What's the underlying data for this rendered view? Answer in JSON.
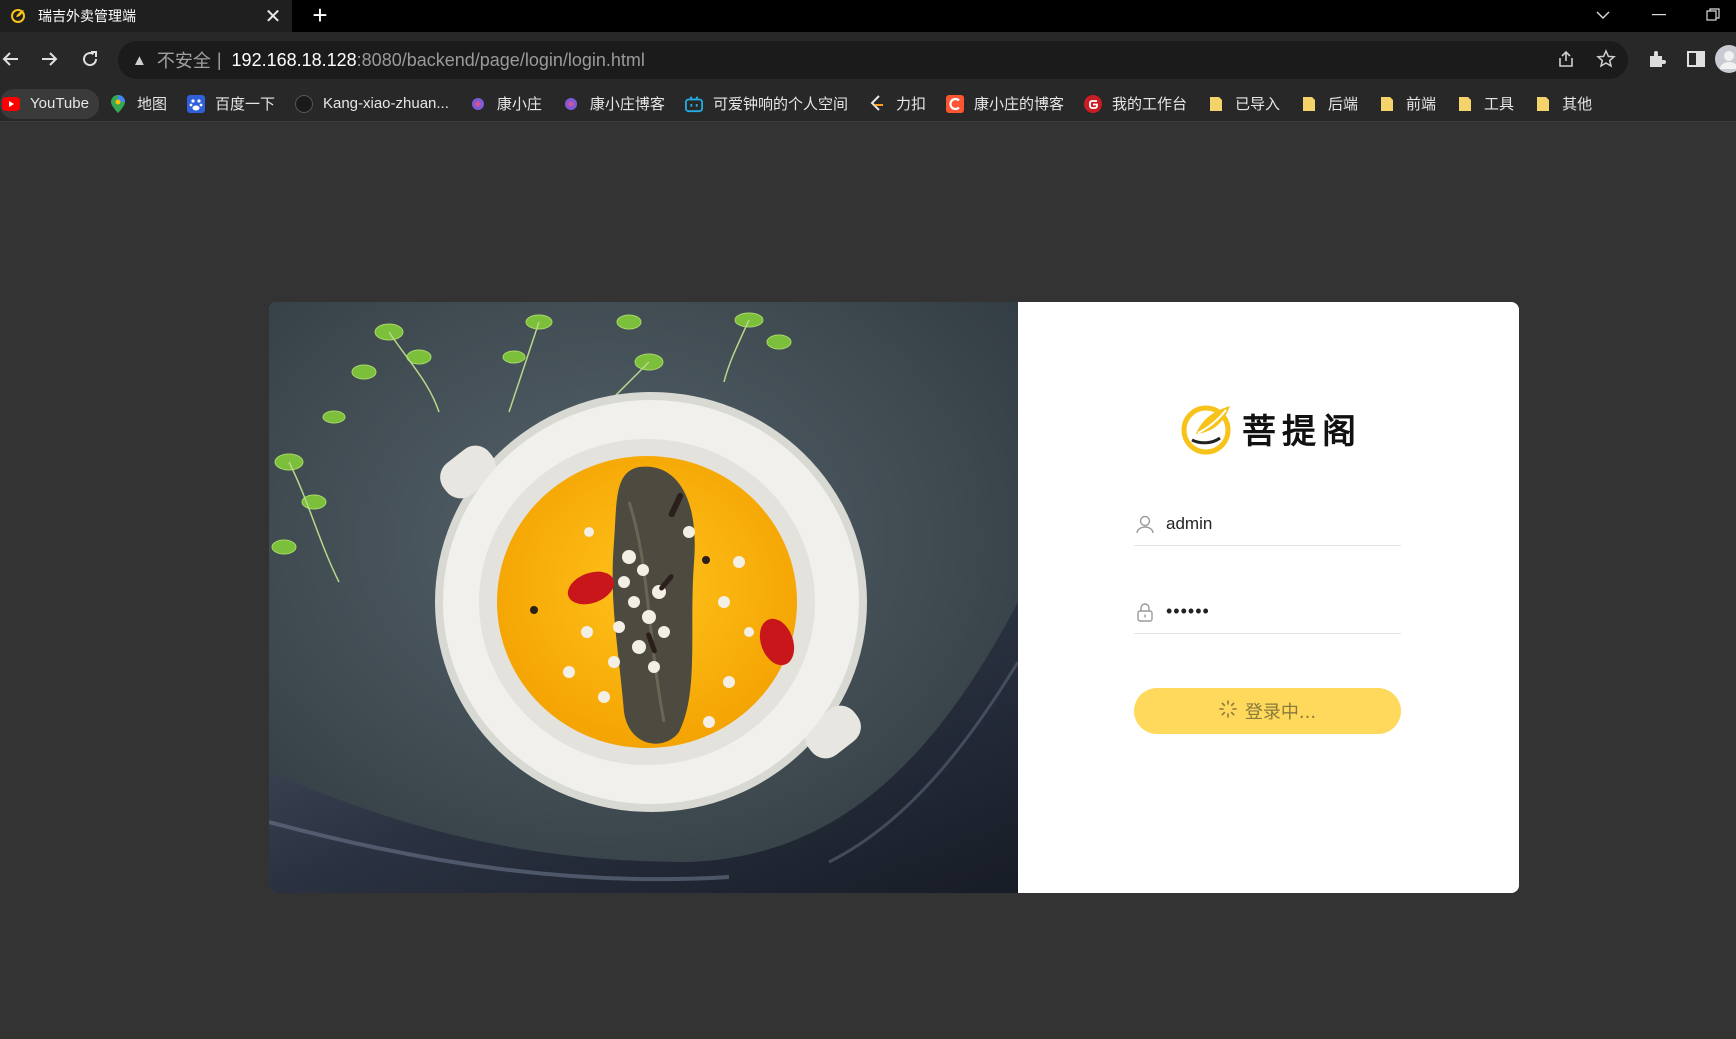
{
  "browser": {
    "tab_title": "瑞吉外卖管理端",
    "tab_close": "✕",
    "new_tab": "+",
    "url_warning": "不安全",
    "url_host": "192.168.18.128",
    "url_path": ":8080/backend/page/login/login.html",
    "bookmarks": [
      {
        "label": "YouTube",
        "icon": "youtube-icon"
      },
      {
        "label": "地图",
        "icon": "maps-pin-icon"
      },
      {
        "label": "百度一下",
        "icon": "baidu-icon"
      },
      {
        "label": "Kang-xiao-zhuan...",
        "icon": "github-icon"
      },
      {
        "label": "康小庄",
        "icon": "site-icon"
      },
      {
        "label": "康小庄博客",
        "icon": "site-icon"
      },
      {
        "label": "可爱钟响的个人空间",
        "icon": "bilibili-icon"
      },
      {
        "label": "力扣",
        "icon": "leetcode-icon"
      },
      {
        "label": "康小庄的博客",
        "icon": "csdn-icon"
      },
      {
        "label": "我的工作台",
        "icon": "gitee-icon"
      },
      {
        "label": "已导入",
        "icon": "folder-icon"
      },
      {
        "label": "后端",
        "icon": "folder-icon"
      },
      {
        "label": "前端",
        "icon": "folder-icon"
      },
      {
        "label": "工具",
        "icon": "folder-icon"
      },
      {
        "label": "其他",
        "icon": "folder-icon"
      }
    ]
  },
  "colors": {
    "accent": "#ffd95c",
    "page_bg": "#333333",
    "logo_yellow": "#f7c21a"
  },
  "login": {
    "brand_name": "菩提阁",
    "username_value": "admin",
    "password_value": "••••••",
    "button_label": "登录中..."
  }
}
